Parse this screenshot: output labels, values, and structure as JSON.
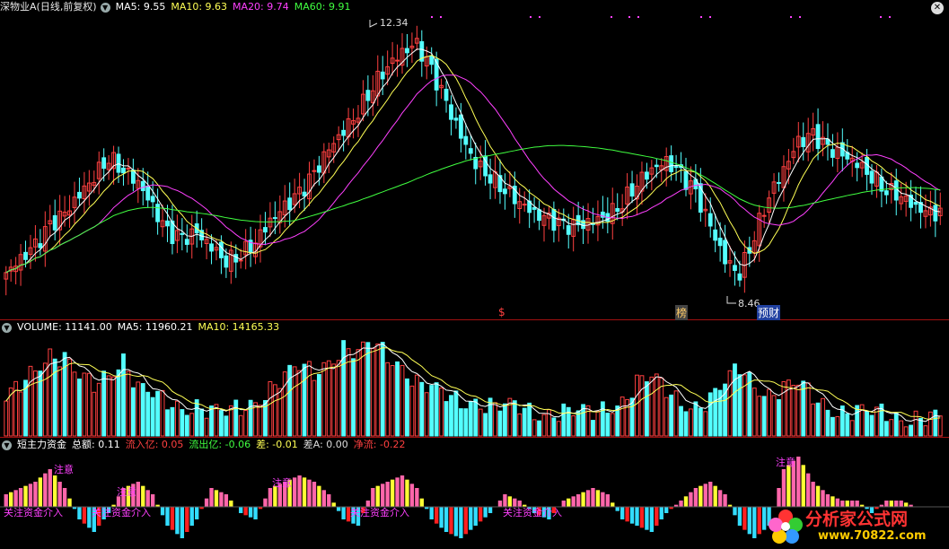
{
  "colors": {
    "up": "#ff4040",
    "down": "#54ffff",
    "ma5": "#ffffff",
    "ma10": "#ffff55",
    "ma20": "#ff40ff",
    "ma60": "#40ff40",
    "bg": "#000000",
    "vol_ma5": "#ffffff",
    "vol_ma10": "#ffff55"
  },
  "price_panel": {
    "title": "深物业A(日线,前复权)",
    "ma5_label": "MA5: 9.55",
    "ma10_label": "MA10: 9.63",
    "ma20_label": "MA20: 9.74",
    "ma60_label": "MA60: 9.91",
    "high_label": "12.34",
    "low_label": "8.46",
    "marks": [
      "$",
      "榜",
      "预财"
    ]
  },
  "volume_panel": {
    "title": "VOLUME: 11141.00",
    "ma5_label": "MA5: 11960.21",
    "ma10_label": "MA10: 14165.33"
  },
  "fund_panel": {
    "title": "短主力资金",
    "total_label": "总额: 0.11",
    "inflow_label": "流入亿: 0.05",
    "outflow_label": "流出亿: -0.06",
    "diff_label": "差: -0.01",
    "diffa_label": "差A: 0.00",
    "net_label": "净流: -0.22",
    "annotation_note": "注意",
    "annotation_buy": "关注资金介入"
  },
  "watermark": {
    "text": "分析家公式网",
    "url": "www.70822.com"
  },
  "chart_data": [
    {
      "type": "candlestick",
      "title": "深物业A(日线,前复权)",
      "ylim": [
        8.2,
        12.6
      ],
      "high": 12.34,
      "low": 8.46,
      "close": [
        8.7,
        8.9,
        9.1,
        9.4,
        9.6,
        9.9,
        10.2,
        10.5,
        10.3,
        10.1,
        9.7,
        9.3,
        9.2,
        9.3,
        9.1,
        8.9,
        9.0,
        9.2,
        9.5,
        9.7,
        9.9,
        10.2,
        10.6,
        10.9,
        11.2,
        11.6,
        11.9,
        12.1,
        12.2,
        11.8,
        11.3,
        10.8,
        10.4,
        10.2,
        10.0,
        9.8,
        9.6,
        9.5,
        9.4,
        9.4,
        9.5,
        9.6,
        9.8,
        10.1,
        10.3,
        10.4,
        10.2,
        9.9,
        9.4,
        8.9,
        8.7,
        9.3,
        9.9,
        10.3,
        10.7,
        10.8,
        10.6,
        10.5,
        10.4,
        10.2,
        10.0,
        9.9,
        9.7,
        9.6
      ]
    },
    {
      "type": "bar",
      "title": "VOLUME",
      "values": [
        6,
        9,
        12,
        14,
        13,
        10,
        9,
        11,
        13,
        8,
        7,
        6,
        5,
        5,
        4,
        4,
        5,
        6,
        8,
        10,
        12,
        11,
        13,
        15,
        14,
        16,
        14,
        12,
        9,
        8,
        7,
        6,
        6,
        5,
        5,
        5,
        4,
        4,
        4,
        4,
        4,
        5,
        6,
        9,
        10,
        8,
        6,
        5,
        6,
        9,
        12,
        9,
        7,
        8,
        9,
        7,
        5,
        4,
        4,
        4,
        4,
        3,
        3,
        3
      ]
    },
    {
      "type": "bar",
      "title": "短主力资金",
      "values": [
        2,
        3,
        4,
        6,
        3,
        -2,
        -4,
        -1,
        3,
        4,
        2,
        -3,
        -5,
        -2,
        3,
        2,
        -1,
        -2,
        3,
        4,
        5,
        4,
        2,
        -2,
        -3,
        3,
        4,
        5,
        3,
        -2,
        -4,
        -5,
        -3,
        -1,
        2,
        1,
        -1,
        -2,
        1,
        2,
        3,
        2,
        -2,
        -3,
        -4,
        -1,
        1,
        3,
        4,
        2,
        -3,
        -5,
        -3,
        6,
        8,
        4,
        2,
        1,
        1,
        -1,
        1,
        1,
        0,
        0
      ]
    }
  ]
}
